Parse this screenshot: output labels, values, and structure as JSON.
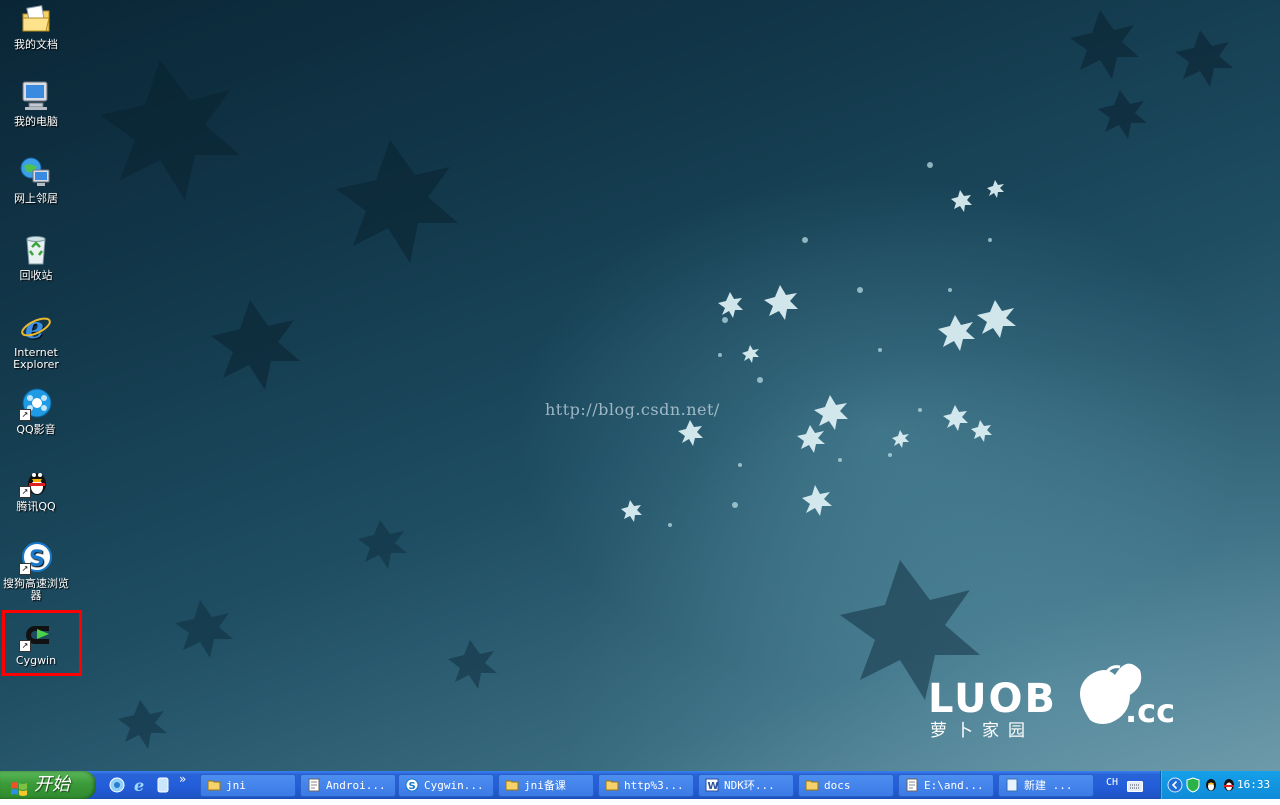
{
  "desktop": {
    "watermark_url": "http://blog.csdn.net/",
    "brand_logo_letters": "LUOB",
    "brand_logo_suffix": ".cc",
    "brand_logo_subtitle": "萝卜家园",
    "icons": [
      {
        "label": "我的文档",
        "icon": "my-documents-icon"
      },
      {
        "label": "我的电脑",
        "icon": "my-computer-icon"
      },
      {
        "label": "网上邻居",
        "icon": "network-places-icon"
      },
      {
        "label": "回收站",
        "icon": "recycle-bin-icon"
      },
      {
        "label": "Internet Explorer",
        "icon": "internet-explorer-icon"
      },
      {
        "label": "QQ影音",
        "icon": "qq-player-icon"
      },
      {
        "label": "腾讯QQ",
        "icon": "qq-penguin-icon"
      },
      {
        "label": "搜狗高速浏览器",
        "icon": "sogou-browser-icon"
      },
      {
        "label": "Cygwin",
        "icon": "cygwin-icon"
      }
    ],
    "highlight_color": "#ff0000"
  },
  "taskbar": {
    "start_label": "开始",
    "quick_launch_more": "»",
    "tasks": [
      {
        "label": "jni",
        "icon": "folder-icon"
      },
      {
        "label": "Androi...",
        "icon": "notepad-icon"
      },
      {
        "label": "Cygwin...",
        "icon": "sogou-browser-icon"
      },
      {
        "label": "jni备课",
        "icon": "folder-icon"
      },
      {
        "label": "http%3...",
        "icon": "folder-icon"
      },
      {
        "label": "NDK环...",
        "icon": "word-document-icon"
      },
      {
        "label": "docs",
        "icon": "folder-icon"
      },
      {
        "label": "E:\\and...",
        "icon": "notepad-icon"
      },
      {
        "label": "新建 ...",
        "icon": "document-icon"
      }
    ],
    "language": "CH",
    "clock": "16:33"
  },
  "colors": {
    "taskbar_blue": "#245edb",
    "start_green": "#3b9b39",
    "tray_blue": "#0f8bd8",
    "task_button_blue": "#3c7ae6"
  }
}
